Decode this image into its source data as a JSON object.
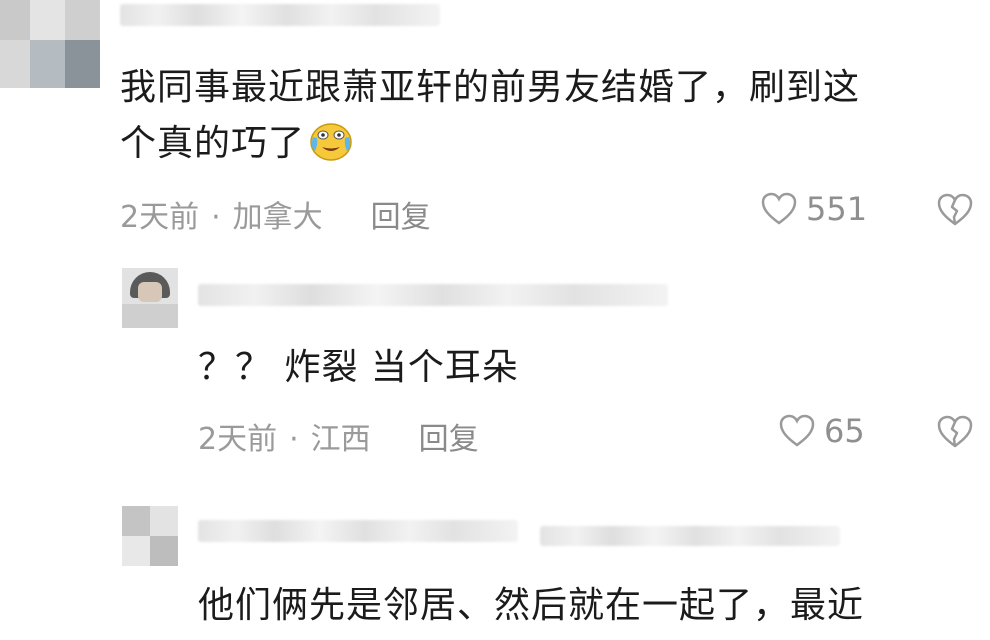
{
  "comments": [
    {
      "text_line1": "我同事最近跟萧亚轩的前男友结婚了，刷到这",
      "text_line2": "个真的巧了",
      "emoji": "crying-laughing-emoji",
      "time": "2天前",
      "location": "加拿大",
      "reply_label": "回复",
      "likes": "551"
    },
    {
      "text": "？？ 炸裂 当个耳朵",
      "time": "2天前",
      "location": "江西",
      "reply_label": "回复",
      "likes": "65"
    },
    {
      "text_line1": "他们俩先是邻居、然后就在一起了，最近"
    }
  ],
  "separator": "·",
  "colors": {
    "text": "#1b1b1b",
    "meta": "#9a9a9a",
    "icon": "#8f8f8f"
  }
}
